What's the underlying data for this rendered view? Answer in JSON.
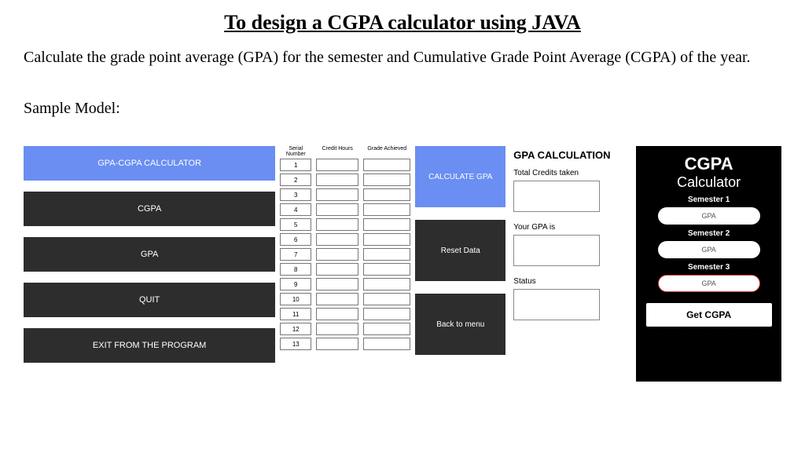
{
  "title": "To design a CGPA calculator using JAVA",
  "description": "Calculate the grade point average (GPA) for the semester and Cumulative Grade Point Average (CGPA) of the year.",
  "sample_label": "Sample Model:",
  "panel1": {
    "top": "GPA-CGPA CALCULATOR",
    "cgpa": "CGPA",
    "gpa": "GPA",
    "quit": "QUIT",
    "exit": "EXIT FROM THE PROGRAM"
  },
  "panel2": {
    "headers": {
      "serial": "Serial Number",
      "credit": "Credit Hours",
      "grade": "Grade Achieved"
    },
    "rows": [
      "1",
      "2",
      "3",
      "4",
      "5",
      "6",
      "7",
      "8",
      "9",
      "10",
      "11",
      "12",
      "13"
    ]
  },
  "panel3": {
    "tiles": {
      "calc": "CALCULATE GPA",
      "reset": "Reset Data",
      "back": "Back to menu"
    },
    "form": {
      "title": "GPA CALCULATION",
      "l1": "Total Credits taken",
      "l2": "Your GPA is",
      "l3": "Status"
    }
  },
  "panel4": {
    "h1": "CGPA",
    "h2": "Calculator",
    "sem1": "Semester 1",
    "sem2": "Semester 2",
    "sem3": "Semester 3",
    "gpa": "GPA",
    "get": "Get CGPA"
  }
}
